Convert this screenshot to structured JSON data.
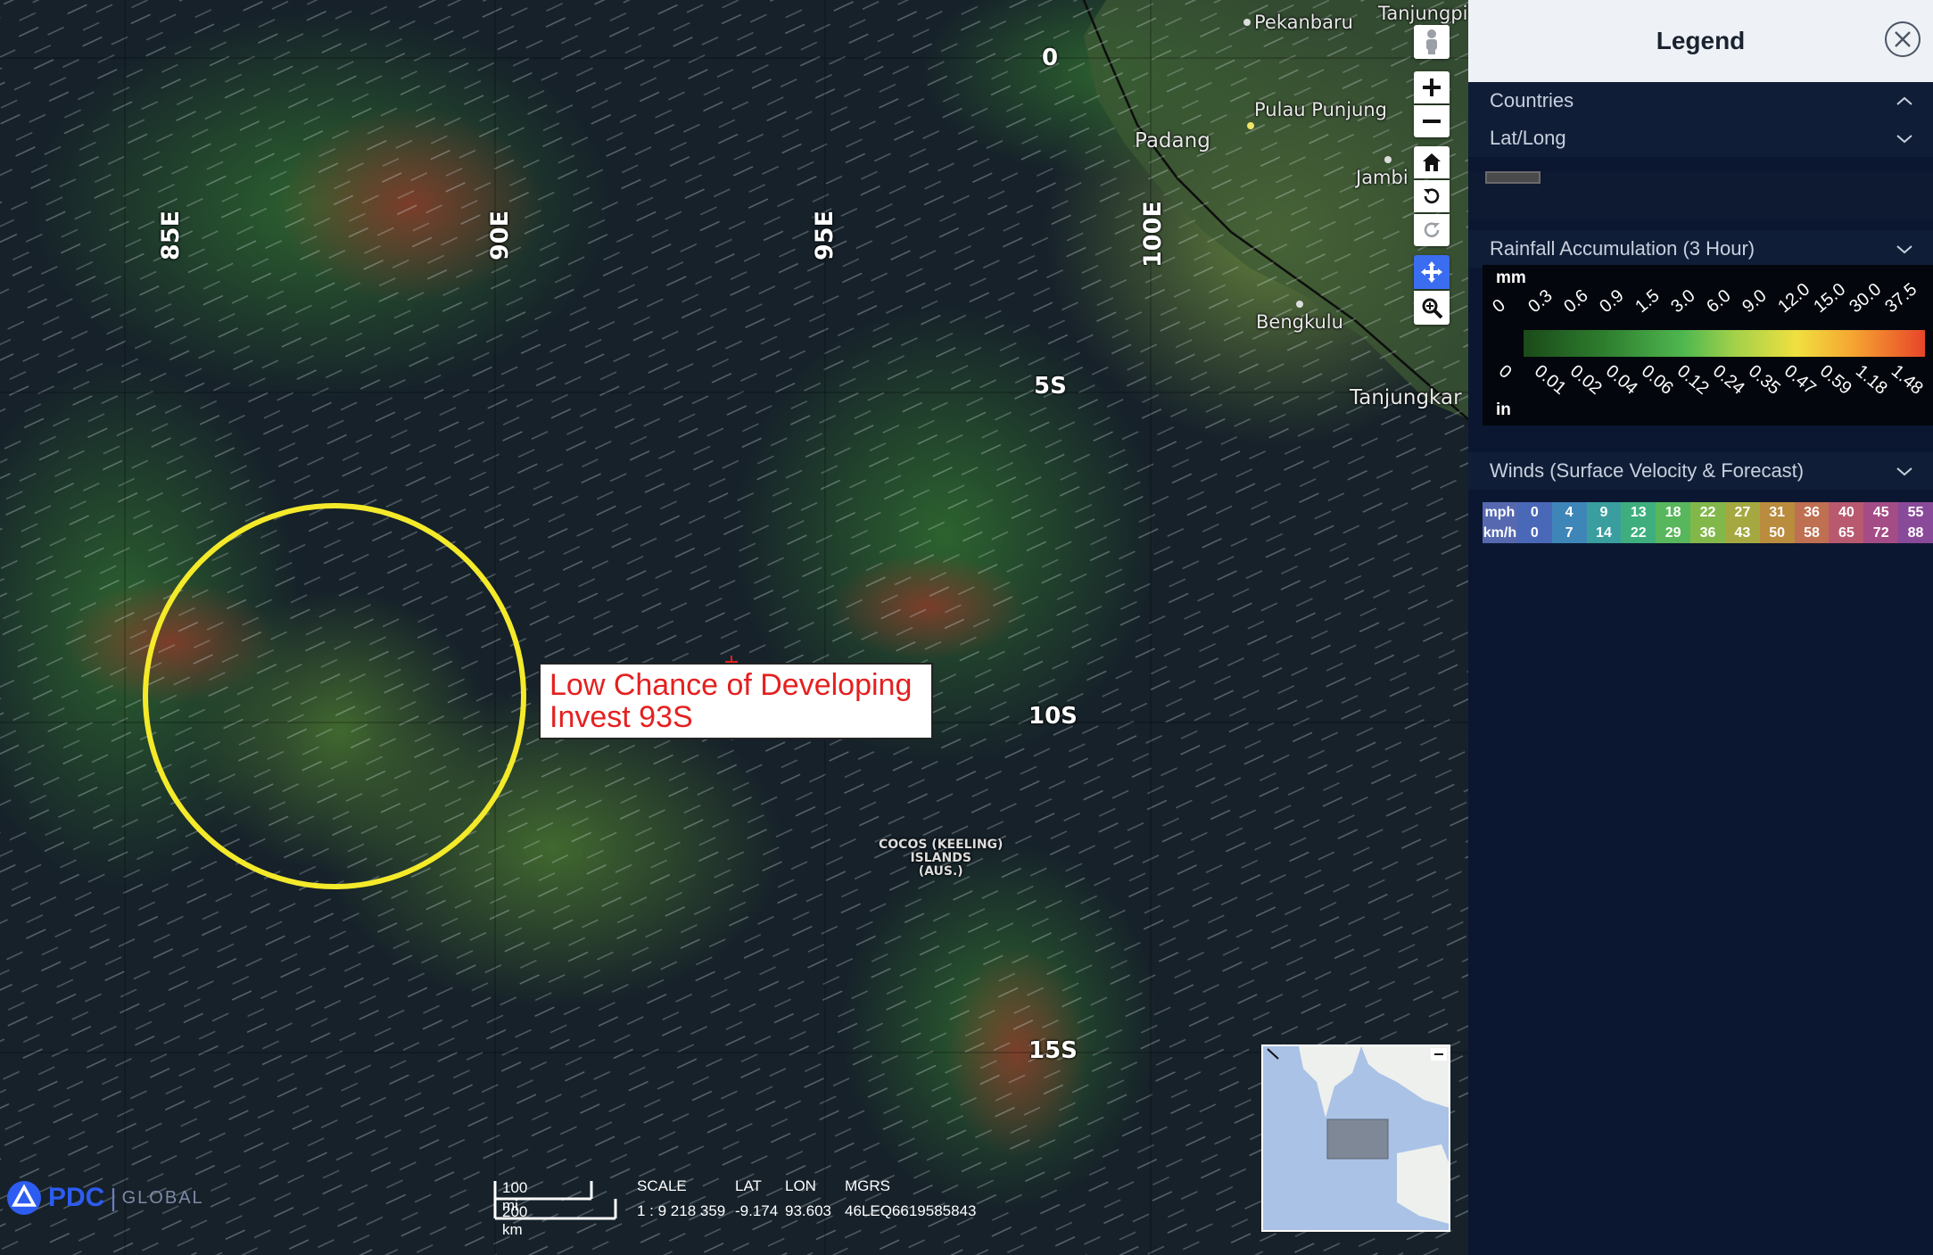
{
  "map": {
    "longitude_labels": [
      "85E",
      "90E",
      "95E",
      "100E"
    ],
    "latitude_labels": [
      "0",
      "5S",
      "10S",
      "15S"
    ],
    "places": [
      "Pekanbaru",
      "Tanjungpi",
      "Pulau Punjung",
      "Padang",
      "Jambi",
      "Bengkulu",
      "Tanjungkar"
    ],
    "island_label": [
      "COCOS (KEELING)",
      "ISLANDS",
      "(AUS.)"
    ],
    "callout": {
      "line1": "Low Chance of Developing",
      "line2": "Invest 93S"
    },
    "highlight_color": "#f4ea2a",
    "callout_text_color": "#e52020"
  },
  "toolbar": {
    "icons": [
      "street-view-icon",
      "zoom-in-icon",
      "zoom-out-icon",
      "home-icon",
      "rotate-left-icon",
      "rotate-right-icon",
      "pan-icon",
      "zoom-box-icon"
    ],
    "active": "pan-icon"
  },
  "footer": {
    "logo_main": "PDC",
    "logo_sub": "GLOBAL",
    "scale_mi": "100 mi",
    "scale_km": "200 km",
    "scale_label": "SCALE",
    "scale_value": "1 : 9 218 359",
    "lat_label": "LAT",
    "lat_value": "-9.174",
    "lon_label": "LON",
    "lon_value": "93.603",
    "mgrs_label": "MGRS",
    "mgrs_value": "46LEQ6619585843"
  },
  "legend": {
    "title": "Legend",
    "sections": {
      "countries": "Countries",
      "latlong": "Lat/Long",
      "rainfall": "Rainfall Accumulation (3 Hour)",
      "winds": "Winds (Surface Velocity & Forecast)"
    },
    "rainfall": {
      "unit_top": "mm",
      "unit_bottom": "in",
      "mm_ticks": [
        "0",
        "0.3",
        "0.6",
        "0.9",
        "1.5",
        "3.0",
        "6.0",
        "9.0",
        "12.0",
        "15.0",
        "30.0",
        "37.5"
      ],
      "in_ticks": [
        "0",
        "0.01",
        "0.02",
        "0.04",
        "0.06",
        "0.12",
        "0.24",
        "0.35",
        "0.47",
        "0.59",
        "1.18",
        "1.48"
      ]
    },
    "winds": {
      "mph_label": "mph",
      "kmh_label": "km/h",
      "mph": [
        "0",
        "4",
        "9",
        "13",
        "18",
        "22",
        "27",
        "31",
        "36",
        "40",
        "45",
        "55"
      ],
      "kmh": [
        "0",
        "7",
        "14",
        "22",
        "29",
        "36",
        "43",
        "50",
        "58",
        "65",
        "72",
        "88"
      ],
      "colors": [
        "#4a68b8",
        "#3f86b8",
        "#3a9e9e",
        "#3fae7f",
        "#58b65c",
        "#82b84a",
        "#a5a840",
        "#b98c3e",
        "#bf6f52",
        "#b8596f",
        "#a44c86",
        "#8a4a9a"
      ]
    }
  }
}
